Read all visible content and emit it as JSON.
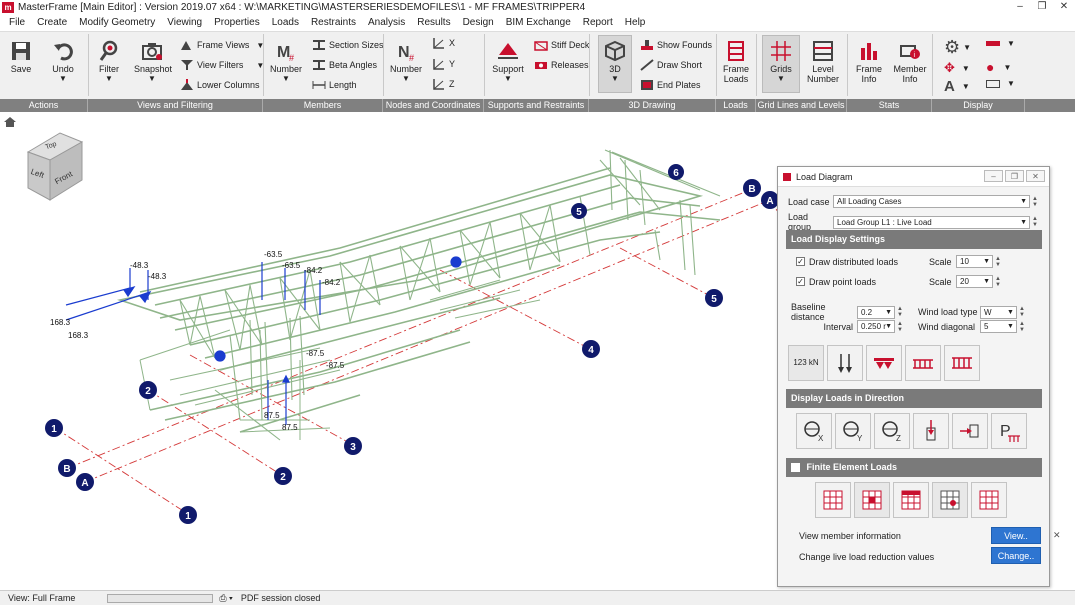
{
  "title_bar": {
    "title": "MasterFrame [Main Editor] : Version 2019.07 x64 : W:\\MARKETING\\MASTERSERIESDEMOFILES\\1 - MF FRAMES\\TRIPPER4",
    "logo_text": "m"
  },
  "menu": [
    "File",
    "Create",
    "Modify Geometry",
    "Viewing",
    "Properties",
    "Loads",
    "Restraints",
    "Analysis",
    "Results",
    "Design",
    "BIM Exchange",
    "Report",
    "Help"
  ],
  "ribbon": {
    "actions": {
      "label": "Actions",
      "save": "Save",
      "undo": "Undo"
    },
    "views": {
      "label": "Views and Filtering",
      "filter": "Filter",
      "snapshot": "Snapshot",
      "frame_views": "Frame Views",
      "view_filters": "View Filters",
      "lower_columns": "Lower Columns"
    },
    "members": {
      "label": "Members",
      "number": "Number",
      "section_sizes": "Section Sizes",
      "beta_angles": "Beta Angles",
      "length": "Length"
    },
    "nodes": {
      "label": "Nodes and Coordinates",
      "number": "Number",
      "x": "X",
      "y": "Y",
      "z": "Z"
    },
    "supports": {
      "label": "Supports and Restraints",
      "support": "Support",
      "stiff_deck": "Stiff Deck",
      "releases": "Releases"
    },
    "drawing3d": {
      "label": "3D Drawing",
      "btn3d": "3D",
      "show_founds": "Show Founds",
      "draw_short": "Draw Short",
      "end_plates": "End Plates"
    },
    "loads": {
      "label": "Loads",
      "frame_loads_1": "Frame",
      "frame_loads_2": "Loads"
    },
    "grid": {
      "label": "Grid Lines and Levels",
      "grids": "Grids",
      "level_1": "Level",
      "level_2": "Number"
    },
    "stats": {
      "label": "Stats",
      "frame_info_1": "Frame",
      "frame_info_2": "Info",
      "member_info_1": "Member",
      "member_info_2": "Info"
    },
    "display": {
      "label": "Display"
    }
  },
  "viewcube": {
    "top": "Top",
    "left": "Left",
    "front": "Front"
  },
  "load_labels": [
    "-48.3",
    "-48.3",
    "-63.5",
    "-63.5",
    "-84.2",
    "-84.2",
    "168.3",
    "168.3",
    "87.5",
    "87.5",
    "-87.5",
    "-87.5"
  ],
  "grid_markers": [
    "1",
    "1",
    "2",
    "2",
    "3",
    "4",
    "5",
    "5",
    "6",
    "A",
    "A",
    "B",
    "B"
  ],
  "status": {
    "view": "View: Full Frame",
    "pdf": "PDF session closed"
  },
  "panel": {
    "title": "Load Diagram",
    "load_case_label": "Load case",
    "load_case_value": "All Loading Cases",
    "load_group_label": "Load group",
    "load_group_value": "Load Group L1 : Live Load",
    "display_settings_head": "Load Display Settings",
    "draw_distributed": "Draw distributed loads",
    "draw_point": "Draw point loads",
    "scale_label": "Scale",
    "scale_distributed": "10",
    "scale_point": "20",
    "baseline_label": "Baseline distance",
    "baseline_value": "0.2",
    "interval_label": "Interval",
    "interval_value": "0.250 r",
    "wind_type_label": "Wind load type",
    "wind_type_value": "W",
    "wind_diag_label": "Wind diagonal",
    "wind_diag_value": "5",
    "btn_kn": "123 kN",
    "direction_head": "Display Loads in Direction",
    "fe_head": "Finite Element Loads",
    "view_member_info": "View member information",
    "view_btn": "View..",
    "live_load_label": "Change live load reduction values",
    "change_btn": "Change.."
  },
  "colors": {
    "ribbon_label_bg": "#808080",
    "brand_red": "#c8102e",
    "frame_green": "#8fb58a",
    "grid_navy": "#101a6b",
    "accent_blue": "#2e75d1"
  }
}
